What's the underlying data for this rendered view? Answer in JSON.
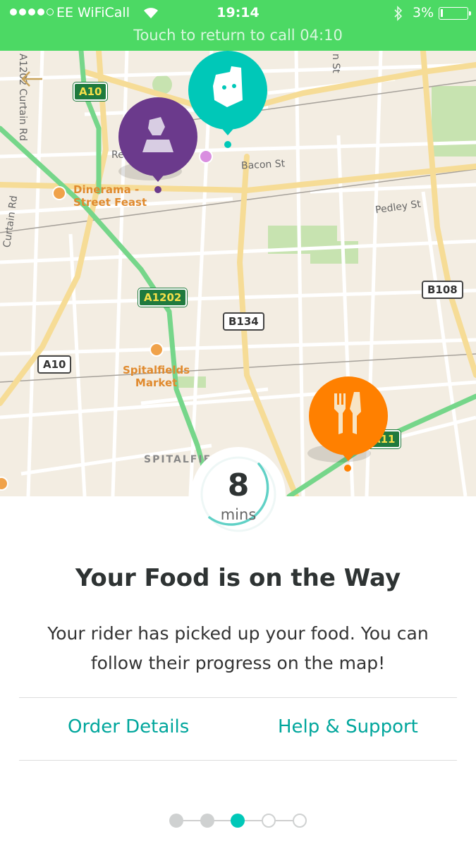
{
  "status_bar": {
    "carrier": "EE WiFiCall",
    "time": "19:14",
    "battery": "3%",
    "battery_level": 0.03,
    "signal_bars": 4,
    "signal_total": 5,
    "call_banner": "Touch to return to call 04:10",
    "background_color": "#4cd964"
  },
  "map": {
    "street_labels": {
      "curtain_rd_1": "A1202 Curtain Rd",
      "curtain_rd_2": "Curtain Rd",
      "bacon_st": "Bacon St",
      "pedley_st": "Pedley St",
      "redchurch": "Re",
      "n_st": "n St",
      "spitalfields": "SPITALFIE"
    },
    "road_shields": {
      "a10_top": "A10",
      "a1202": "A1202",
      "b134": "B134",
      "b108": "B108",
      "a10_left": "A10",
      "a11": "A11"
    },
    "pois": {
      "dinerama": "Dinerama -\nStreet Feast",
      "spitalfields_market": "Spitalfields\nMarket"
    },
    "pins": {
      "rider": {
        "icon": "deliveroo-kangaroo-icon",
        "color": "#00c8b8"
      },
      "customer": {
        "icon": "user-icon",
        "color": "#6b3a8c"
      },
      "restaurant": {
        "icon": "cutlery-icon",
        "color": "#ff8000"
      }
    }
  },
  "eta": {
    "value": "8",
    "unit": "mins",
    "ring_color": "#60d1c6"
  },
  "headline": "Your Food is on the Way",
  "message": "Your rider has picked up your food. You can follow their progress on the map!",
  "actions": {
    "order_details": "Order Details",
    "help_support": "Help & Support",
    "color": "#00a69c"
  },
  "pager": {
    "total": 5,
    "current": 3,
    "dot_states": [
      "complete",
      "complete",
      "current",
      "pending",
      "pending"
    ],
    "colors": {
      "complete": "#cfd1d1",
      "current": "#00c8b8",
      "pending_border": "#cfd1d1"
    }
  }
}
